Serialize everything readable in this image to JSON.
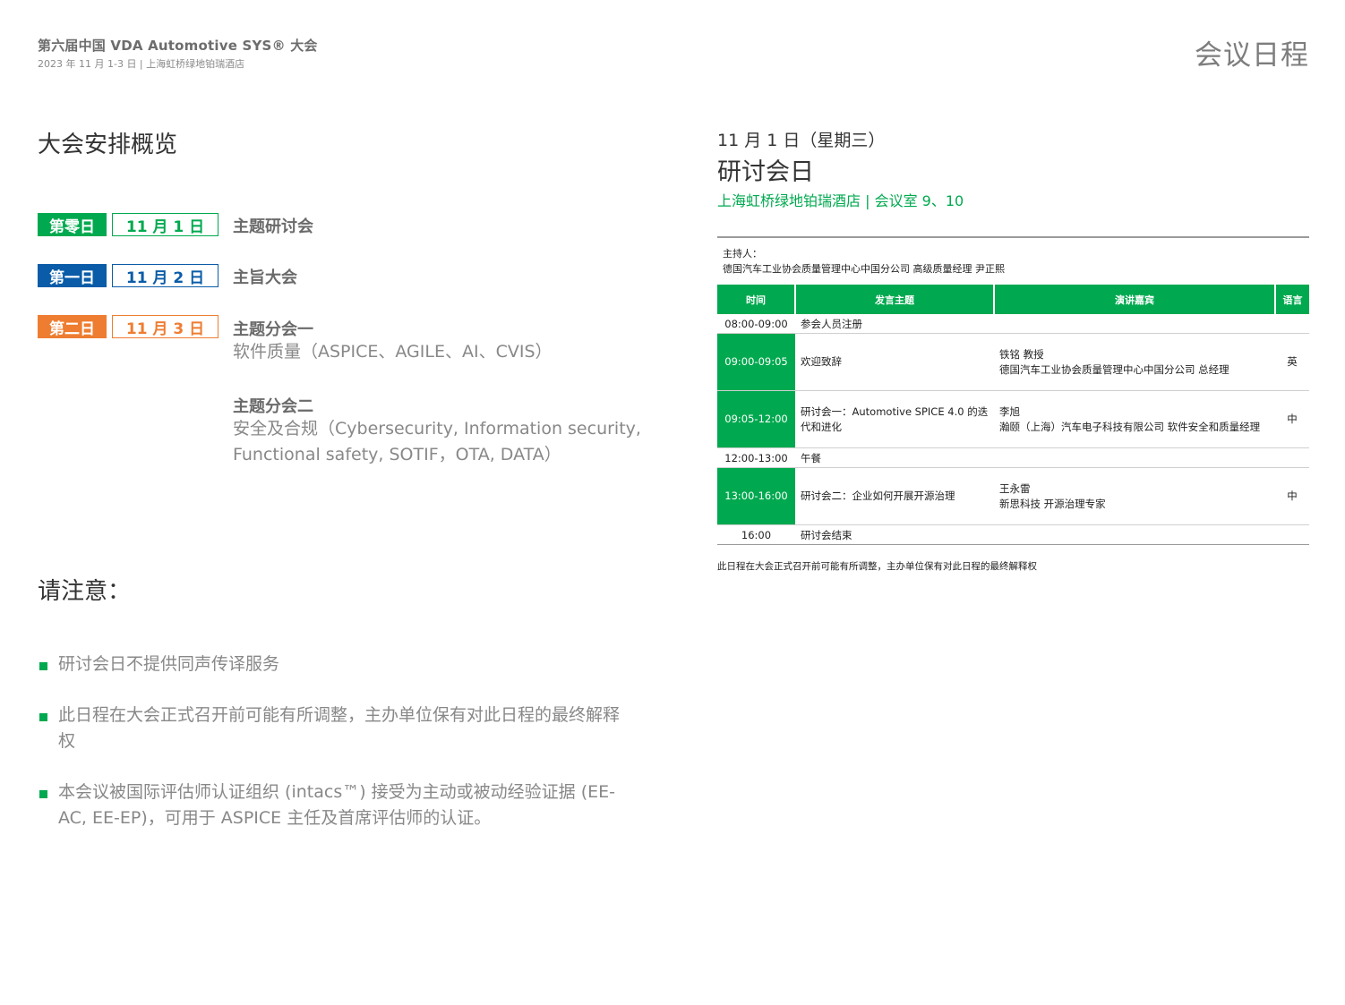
{
  "header": {
    "conf_title": "第六届中国 VDA Automotive SYS® 大会",
    "conf_sub": "2023 年 11 月 1-3 日 | 上海虹桥绿地铂瑞酒店",
    "page_title": "会议日程"
  },
  "overview": {
    "title": "大会安排概览",
    "days": [
      {
        "badge": "第零日",
        "date": "11 月 1 日",
        "session": "主题研讨会",
        "color": "#00a94f"
      },
      {
        "badge": "第一日",
        "date": "11 月 2 日",
        "session": "主旨大会",
        "color": "#0a5ca8"
      },
      {
        "badge": "第二日",
        "date": "11 月 3 日",
        "session": "主题分会一",
        "color": "#ee7d31"
      }
    ],
    "session1_desc": "软件质量（ASPICE、AGILE、AI、CVIS）",
    "session2_title": "主题分会二",
    "session2_desc_1": "安全及合规（Cybersecurity, Information security,",
    "session2_desc_2": "Functional safety, SOTIF，OTA, DATA）"
  },
  "notes": {
    "title": "请注意：",
    "items": [
      "研讨会日不提供同声传译服务",
      "此日程在大会正式召开前可能有所调整，主办单位保有对此日程的最终解释权",
      "本会议被国际评估师认证组织 (intacs™) 接受为主动或被动经验证据 (EE-AC, EE-EP)，可用于 ASPICE 主任及首席评估师的认证。"
    ]
  },
  "schedule": {
    "date": "11 月 1 日（星期三）",
    "day_title": "研讨会日",
    "venue": "上海虹桥绿地铂瑞酒店 | 会议室  9、10",
    "host_label": "主持人：",
    "host_name": "德国汽车工业协会质量管理中心中国分公司 高级质量经理 尹正熙",
    "headers": [
      "时间",
      "发言主题",
      "演讲嘉宾",
      "语言"
    ],
    "rows": [
      {
        "time": "08:00-09:00",
        "topic": "参会人员注册",
        "speaker_name": "",
        "speaker_org": "",
        "lang": ""
      },
      {
        "time": "09:00-09:05",
        "topic": "欢迎致辞",
        "speaker_name": "铁铭 教授",
        "speaker_org": "德国汽车工业协会质量管理中心中国分公司 总经理",
        "lang": "英"
      },
      {
        "time": "09:05-12:00",
        "topic": "研讨会一：Automotive SPICE 4.0 的迭代和进化",
        "speaker_name": "李旭",
        "speaker_org": "瀚颐（上海）汽车电子科技有限公司 软件安全和质量经理",
        "lang": "中"
      },
      {
        "time": "12:00-13:00",
        "topic": "午餐",
        "speaker_name": "",
        "speaker_org": "",
        "lang": ""
      },
      {
        "time": "13:00-16:00",
        "topic": "研讨会二：企业如何开展开源治理",
        "speaker_name": "王永雷",
        "speaker_org": "新思科技 开源治理专家",
        "lang": "中"
      },
      {
        "time": "16:00",
        "topic": "研讨会结束",
        "speaker_name": "",
        "speaker_org": "",
        "lang": ""
      }
    ],
    "footnote": "此日程在大会正式召开前可能有所调整，主办单位保有对此日程的最终解释权"
  }
}
